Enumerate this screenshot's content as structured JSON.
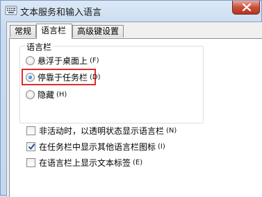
{
  "window": {
    "title": "文本服务和输入语言"
  },
  "tabs": [
    {
      "label": "常规",
      "active": false
    },
    {
      "label": "语言栏",
      "active": true
    },
    {
      "label": "高级键设置",
      "active": false
    }
  ],
  "language_bar": {
    "group_label": "语言栏",
    "options": [
      {
        "label": "悬浮于桌面上",
        "shortcut": "(F)",
        "selected": false
      },
      {
        "label": "停靠于任务栏",
        "shortcut": "(D)",
        "selected": true
      },
      {
        "label": "隐藏",
        "shortcut": "(H)",
        "selected": false
      }
    ]
  },
  "checkboxes": [
    {
      "label": "非活动时，以透明状态显示语言栏",
      "shortcut": "(N)",
      "checked": false
    },
    {
      "label": "在任务栏中显示其他语言栏图标",
      "shortcut": "(I)",
      "checked": true
    },
    {
      "label": "在语言栏上显示文本标签",
      "shortcut": "(E)",
      "checked": false
    }
  ],
  "colors": {
    "highlight_box": "#e12a2a",
    "title_bar": "#c9dbef",
    "close_button": "#c9503b"
  }
}
